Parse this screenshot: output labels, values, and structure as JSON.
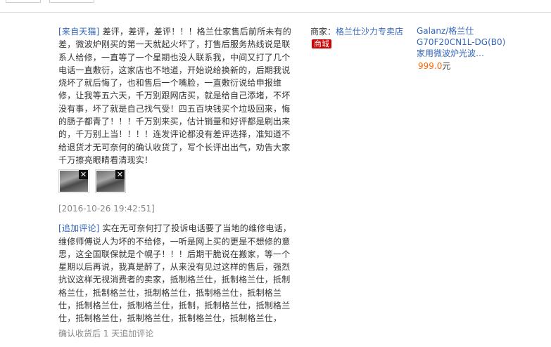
{
  "review": {
    "source_tag": "[来自天猫]",
    "text": "差评，差评，差评！！！格兰仕家售后前所未有的差，微波炉刚买的第一天就起火坏了，打售后服务热线说是联系人给修，一直等了一个星期也没人联系我，中间又打了几个电话一直敷衍，这家店也不地道，开始说给换新的，后期我说烧坏了就后悔了，也和售后一个嘴脸，一直敷衍说给申报维修，让我等五六天，千万别跟网店买，就是给自己添堵，不坏没有事，坏了就是自己找气受！四五百块钱买个垃圾回来，悔的肠子都青了！！！千万别来买，估计销量和好评都是刷出来的，千万别上当！！！！连发评论都没有差评选择，准知道不给退货才无可奈何的确认收货了，写个长评出出气，劝告大家千万擦亮眼睛看清现实！",
    "photo_remove_glyph": "✕",
    "timestamp": "[2016-10-26 19:42:51]",
    "append_tag": "[追加评论]",
    "append_text": "实在无可奈何打了投诉电话要了当地的维修电话，维修师傅说人为坏的不给修，一听是网上买的更是不想修的意思，这全国联保就是个幌子！！！后期干脆说在搬家，等一个星期以后再说，我真是醉了，从来没有见过这样的售后，强烈抗议这样无视消费者的卖家，抵制格兰仕，抵制格兰仕，抵制格兰仕，抵制格兰仕，抵制格兰仕，抵制格兰仕，抵制格兰仕，抵制格兰仕，抵制格兰仕，抵制，抵制格兰仕，抵制格兰仕，抵制格兰仕，抵制格兰仕，抵制格兰仕，抵制格兰仕，",
    "append_note": "确认收货后 1 天追加评论"
  },
  "shop": {
    "label": "商家：",
    "name": "格兰仕沙力专卖店",
    "badge": "商城"
  },
  "item": {
    "name": "Galanz/格兰仕G70F20CN1L-DG(B0)家用微波炉光波…",
    "price": "999.0",
    "currency": "元"
  },
  "colors": {
    "link": "#3366bb",
    "price": "#ff6600",
    "badge": "#cc0000",
    "muted": "#888888"
  }
}
